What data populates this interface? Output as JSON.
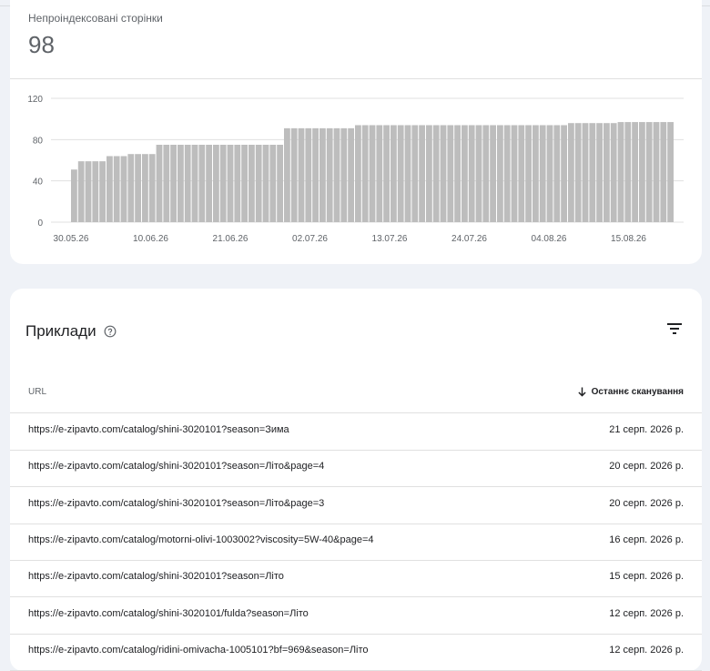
{
  "summary": {
    "metric_label": "Непроіндексовані сторінки",
    "metric_value": "98"
  },
  "chart_data": {
    "type": "bar",
    "title": "",
    "xlabel": "",
    "ylabel": "",
    "ylim": [
      0,
      120
    ],
    "y_ticks": [
      "0",
      "40",
      "80",
      "120"
    ],
    "x_tick_labels": [
      "30.05.26",
      "10.06.26",
      "21.06.26",
      "02.07.26",
      "13.07.26",
      "24.07.26",
      "04.08.26",
      "15.08.26"
    ],
    "values": [
      51,
      59,
      59,
      59,
      59,
      64,
      64,
      64,
      66,
      66,
      66,
      66,
      75,
      75,
      75,
      75,
      75,
      75,
      75,
      75,
      75,
      75,
      75,
      75,
      75,
      75,
      75,
      75,
      75,
      75,
      91,
      91,
      91,
      91,
      91,
      91,
      91,
      91,
      91,
      91,
      94,
      94,
      94,
      94,
      94,
      94,
      94,
      94,
      94,
      94,
      94,
      94,
      94,
      94,
      94,
      94,
      94,
      94,
      94,
      94,
      94,
      94,
      94,
      94,
      94,
      94,
      94,
      94,
      94,
      94,
      96,
      96,
      96,
      96,
      96,
      96,
      96,
      97,
      97,
      97,
      97,
      97,
      97,
      97,
      97
    ],
    "grid": true,
    "color": "#bdbdbd"
  },
  "examples": {
    "title": "Приклади",
    "help_icon": "help-circle-icon",
    "filter_icon": "filter-icon",
    "columns": {
      "url": "URL",
      "last_crawl": "Останнє сканування"
    },
    "rows": [
      {
        "url": "https://e-zipavto.com/catalog/shini-3020101?season=Зима",
        "date": "21 серп. 2026 р."
      },
      {
        "url": "https://e-zipavto.com/catalog/shini-3020101?season=Літо&page=4",
        "date": "20 серп. 2026 р."
      },
      {
        "url": "https://e-zipavto.com/catalog/shini-3020101?season=Літо&page=3",
        "date": "20 серп. 2026 р."
      },
      {
        "url": "https://e-zipavto.com/catalog/motorni-olivi-1003002?viscosity=5W-40&page=4",
        "date": "16 серп. 2026 р."
      },
      {
        "url": "https://e-zipavto.com/catalog/shini-3020101?season=Літо",
        "date": "15 серп. 2026 р."
      },
      {
        "url": "https://e-zipavto.com/catalog/shini-3020101/fulda?season=Літо",
        "date": "12 серп. 2026 р."
      },
      {
        "url": "https://e-zipavto.com/catalog/ridini-omivacha-1005101?bf=969&season=Літо",
        "date": "12 серп. 2026 р."
      }
    ]
  }
}
